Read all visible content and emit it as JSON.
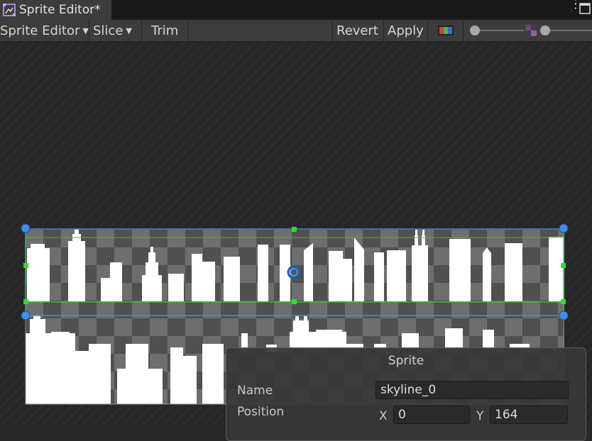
{
  "tab": {
    "title": "Sprite Editor*",
    "icon": "sprite-editor-icon"
  },
  "window_icons": [
    "kebab-menu-icon",
    "maximize-icon"
  ],
  "toolbar": {
    "mode_label": "Sprite Editor",
    "slice_label": "Slice",
    "trim_label": "Trim",
    "revert_label": "Revert",
    "apply_label": "Apply",
    "icons": [
      "color-channels-icon",
      "zoom-slider",
      "mip-level-icon",
      "mip-slider"
    ]
  },
  "inspector": {
    "title": "Sprite",
    "name_label": "Name",
    "name_value": "skyline_0",
    "position_label": "Position",
    "x_label": "X",
    "x_value": "0",
    "y_label": "Y",
    "y_value": "164"
  },
  "colors": {
    "accent": "#3f8ee8",
    "handle_green": "#28e028",
    "background": "#282828"
  }
}
